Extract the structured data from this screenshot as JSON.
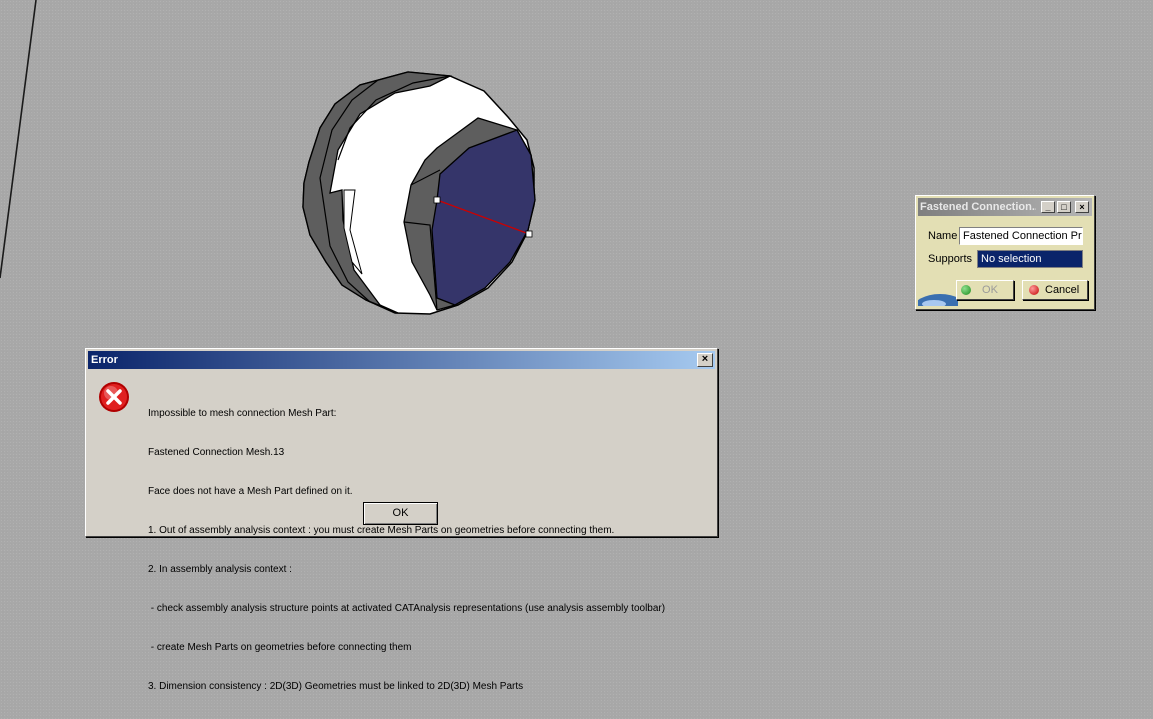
{
  "fastened_panel": {
    "title": "Fastened Connection...",
    "name_label": "Name",
    "name_value": "Fastened Connection Pr",
    "supports_label": "Supports",
    "supports_value": "No selection",
    "ok_label": "OK",
    "cancel_label": "Cancel",
    "minimize_icon": "minimize-icon",
    "maximize_icon": "maximize-icon",
    "close_icon": "close-icon"
  },
  "error_dialog": {
    "title": "Error",
    "icon": "error-icon",
    "lines": [
      "Impossible to mesh connection Mesh Part:",
      "Fastened Connection Mesh.13",
      "Face does not have a Mesh Part defined on it.",
      "1. Out of assembly analysis context : you must create Mesh Parts on geometries before connecting them.",
      "2. In assembly analysis context :",
      " - check assembly analysis structure points at activated CATAnalysis representations (use analysis assembly toolbar)",
      " - create Mesh Parts on geometries before connecting them",
      "3. Dimension consistency : 2D(3D) Geometries must be linked to 2D(3D) Mesh Parts"
    ],
    "ok_label": "OK"
  },
  "colors": {
    "background": "#a8a8a8",
    "face_fill": "#35356a",
    "shell_fill": "#5e5e5e",
    "measure_line": "#cc0000",
    "error_title": "#0a246a"
  }
}
